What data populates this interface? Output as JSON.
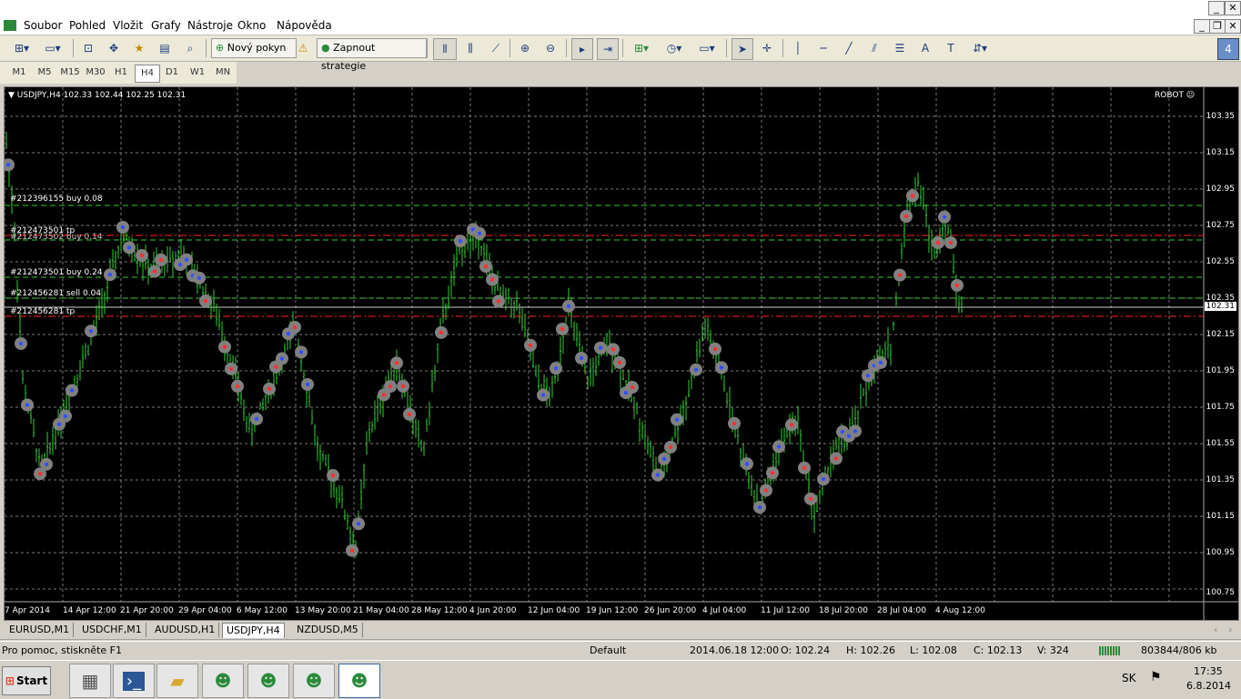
{
  "menu": [
    "Soubor",
    "Pohled",
    "Vložit",
    "Grafy",
    "Nástroje",
    "Okno",
    "Nápověda"
  ],
  "toolbar": {
    "new_order": "Nový pokyn",
    "autotrading": "Zapnout strategie",
    "alert_badge": "4"
  },
  "timeframes": [
    "M1",
    "M5",
    "M15",
    "M30",
    "H1",
    "H4",
    "D1",
    "W1",
    "MN"
  ],
  "active_timeframe": "H4",
  "chart": {
    "header": "USDJPY,H4  102.33 102.44 102.25 102.31",
    "robot": "ROBOT ☺",
    "current_price": "102.31",
    "price_labels": [
      "103.35",
      "103.15",
      "102.95",
      "102.75",
      "102.55",
      "102.35",
      "102.15",
      "101.95",
      "101.75",
      "101.55",
      "101.35",
      "101.15",
      "100.95",
      "100.75"
    ],
    "date_labels": [
      "7 Apr 2014",
      "14 Apr 12:00",
      "21 Apr 20:00",
      "29 Apr 04:00",
      "6 May 12:00",
      "13 May 20:00",
      "21 May 04:00",
      "28 May 12:00",
      "4 Jun 20:00",
      "12 Jun 04:00",
      "19 Jun 12:00",
      "26 Jun 20:00",
      "4 Jul 04:00",
      "11 Jul 12:00",
      "18 Jul 20:00",
      "28 Jul 04:00",
      "4 Aug 12:00"
    ],
    "order_labels": [
      "#212396155 buy 0.08",
      "#212473501 tp",
      "#212473502 buy 0.14",
      "#212473501 buy 0.24",
      "#212456281 sell 0.04",
      "#212456281 tp"
    ],
    "colors": {
      "background": "#000000",
      "grid": "#777777",
      "candle": "#33cc33",
      "buy_line": "#33cc33",
      "tp_line": "#ff2020",
      "marker_ring": "#808080"
    }
  },
  "tabs": [
    "EURUSD,M1",
    "USDCHF,M1",
    "AUDUSD,H1",
    "USDJPY,H4",
    "NZDUSD,M5"
  ],
  "active_tab": "USDJPY,H4",
  "status": {
    "help": "Pro pomoc, stiskněte F1",
    "profile": "Default",
    "datetime": "2014.06.18 12:00",
    "open": "O: 102.24",
    "high": "H: 102.26",
    "low": "L: 102.08",
    "close": "C: 102.13",
    "volume": "V: 324",
    "traffic": "803844/806 kb"
  },
  "taskbar": {
    "start": "Start",
    "lang": "SK",
    "time": "17:35",
    "date": "6.8.2014"
  }
}
